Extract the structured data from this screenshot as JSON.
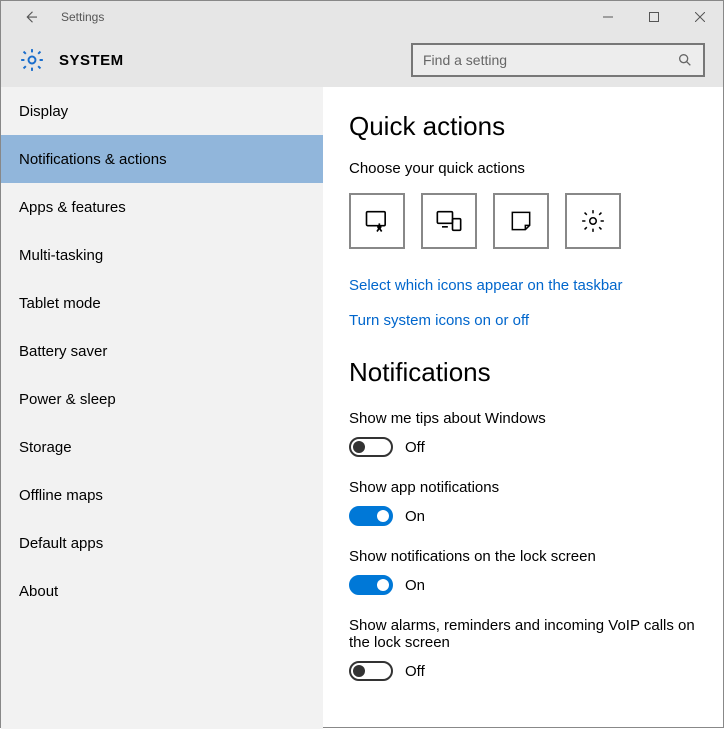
{
  "window": {
    "title": "Settings"
  },
  "header": {
    "system_label": "SYSTEM"
  },
  "search": {
    "placeholder": "Find a setting"
  },
  "sidebar": {
    "items": [
      {
        "label": "Display"
      },
      {
        "label": "Notifications & actions"
      },
      {
        "label": "Apps & features"
      },
      {
        "label": "Multi-tasking"
      },
      {
        "label": "Tablet mode"
      },
      {
        "label": "Battery saver"
      },
      {
        "label": "Power & sleep"
      },
      {
        "label": "Storage"
      },
      {
        "label": "Offline maps"
      },
      {
        "label": "Default apps"
      },
      {
        "label": "About"
      }
    ],
    "selected_index": 1
  },
  "quick_actions": {
    "heading": "Quick actions",
    "caption": "Choose your quick actions",
    "tiles": [
      {
        "icon": "tablet-touch-icon"
      },
      {
        "icon": "project-icon"
      },
      {
        "icon": "note-icon"
      },
      {
        "icon": "gear-icon"
      }
    ],
    "links": [
      "Select which icons appear on the taskbar",
      "Turn system icons on or off"
    ]
  },
  "notifications": {
    "heading": "Notifications",
    "toggles": [
      {
        "label": "Show me tips about Windows",
        "on": false,
        "state": "Off"
      },
      {
        "label": "Show app notifications",
        "on": true,
        "state": "On"
      },
      {
        "label": "Show notifications on the lock screen",
        "on": true,
        "state": "On"
      },
      {
        "label": "Show alarms, reminders and incoming VoIP calls on the lock screen",
        "on": false,
        "state": "Off"
      }
    ]
  }
}
